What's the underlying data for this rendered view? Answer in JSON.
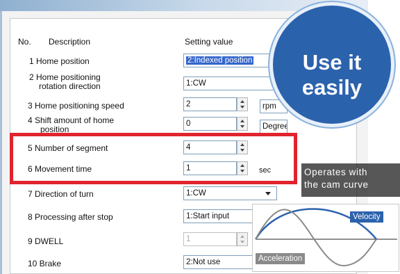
{
  "dialog": {
    "header": {
      "no": "No.",
      "description": "Description",
      "setting_value": "Setting value"
    },
    "rows": [
      {
        "label": "1 Home position",
        "value": "2:Indexed position"
      },
      {
        "label": "2 Home positioning",
        "label2": "rotation direction",
        "value": "1:CW"
      },
      {
        "label": "3 Home positioning speed",
        "value": "2",
        "unit": "rpm"
      },
      {
        "label": "4 Shift amount of home",
        "label2": "position",
        "value": "0",
        "unit": "Degree"
      },
      {
        "label": "5 Number of segment",
        "value": "4"
      },
      {
        "label": "6 Movement time",
        "value": "1",
        "unit": "sec"
      },
      {
        "label": "7 Direction of turn",
        "value": "1:CW"
      },
      {
        "label": "8 Processing after stop",
        "value": "1:Start input"
      },
      {
        "label": "9 DWELL",
        "value": "1"
      },
      {
        "label": "10 Brake",
        "value": "2:Not use"
      }
    ]
  },
  "badge": {
    "text": "Use it easily"
  },
  "cam_caption": {
    "line1": "Operates with",
    "line2": "the cam curve"
  },
  "graph": {
    "velocity_label": "Velocity",
    "acceleration_label": "Acceleration"
  },
  "colors": {
    "badge_blue": "#2b62ac",
    "highlight_red": "#e0242e",
    "velocity_blue": "#2b62ac",
    "acceleration_gray": "#8a8a8a",
    "selection_blue": "#3366cc"
  }
}
